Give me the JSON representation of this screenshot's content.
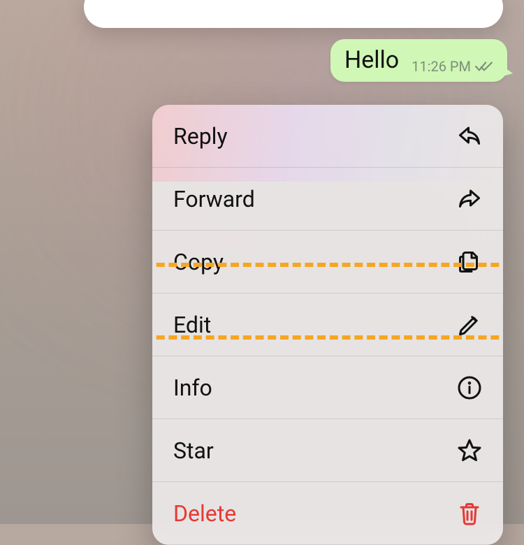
{
  "message": {
    "text": "Hello",
    "time": "11:26 PM"
  },
  "menu": {
    "reply": {
      "label": "Reply"
    },
    "forward": {
      "label": "Forward"
    },
    "copy": {
      "label": "Copy"
    },
    "edit": {
      "label": "Edit"
    },
    "info": {
      "label": "Info"
    },
    "star": {
      "label": "Star"
    },
    "delete": {
      "label": "Delete"
    }
  }
}
